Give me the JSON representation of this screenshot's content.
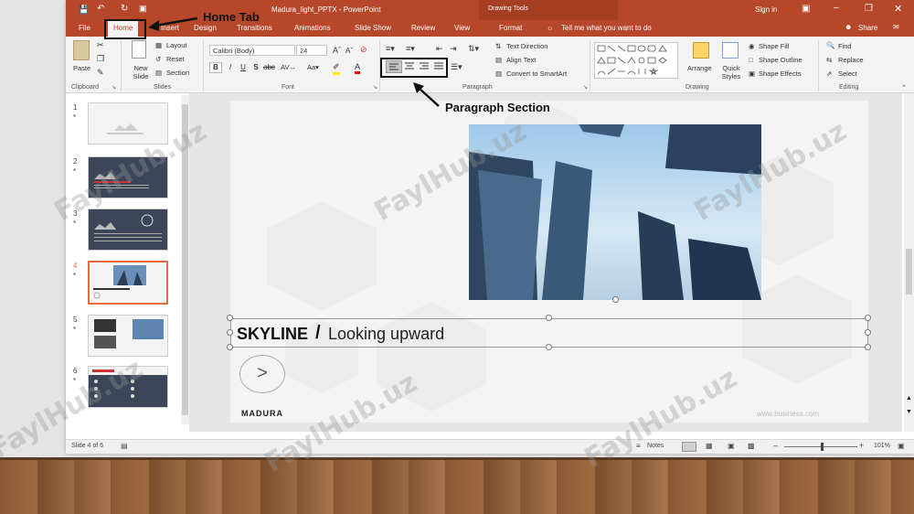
{
  "app": {
    "doc_title": "Madura_light_PPTX - PowerPoint",
    "contextual_group": "Drawing Tools",
    "sign_in": "Sign in",
    "share": "Share"
  },
  "tabs": [
    "File",
    "Home",
    "Insert",
    "Design",
    "Transitions",
    "Animations",
    "Slide Show",
    "Review",
    "View",
    "Format"
  ],
  "tell_me": "Tell me what you want to do",
  "ribbon": {
    "clipboard": {
      "paste": "Paste",
      "label": "Clipboard"
    },
    "slides": {
      "new_slide": "New Slide",
      "layout": "Layout",
      "reset": "Reset",
      "section": "Section",
      "label": "Slides"
    },
    "font": {
      "name": "Calibri (Body)",
      "size": "24",
      "label": "Font"
    },
    "paragraph": {
      "text_direction": "Text Direction",
      "align_text": "Align Text",
      "smartart": "Convert to SmartArt",
      "label": "Paragraph"
    },
    "drawing": {
      "arrange": "Arrange",
      "quick_styles": "Quick Styles",
      "shape_fill": "Shape Fill",
      "shape_outline": "Shape Outline",
      "shape_effects": "Shape Effects",
      "label": "Drawing"
    },
    "editing": {
      "find": "Find",
      "replace": "Replace",
      "select": "Select",
      "label": "Editing"
    }
  },
  "annotations": {
    "home_tab": "Home Tab",
    "paragraph_section": "Paragraph Section"
  },
  "thumbnails": [
    "1",
    "2",
    "3",
    "4",
    "5",
    "6"
  ],
  "slide": {
    "title_bold": "SKYLINE",
    "title_sep": "/",
    "title_rest": "Looking upward",
    "arrow": ">",
    "logo": "MADURA",
    "url": "www.business.com"
  },
  "status": {
    "slide_count": "Slide 4 of 6",
    "notes": "Notes",
    "zoom": "101%"
  },
  "watermark": "FaylHub.uz",
  "colors": {
    "accent": "#b7472a",
    "selected_thumb": "#e96a3c"
  }
}
